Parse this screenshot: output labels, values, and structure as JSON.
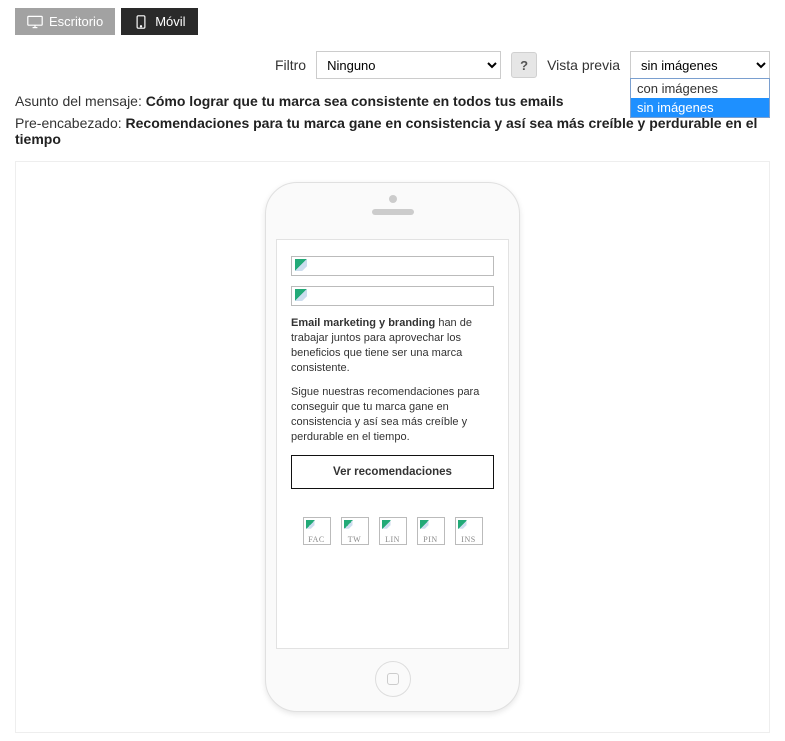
{
  "view_toggle": {
    "desktop_label": "Escritorio",
    "mobile_label": "Móvil"
  },
  "controls": {
    "filter_label": "Filtro",
    "filter_value": "Ninguno",
    "help_icon": "?",
    "preview_label": "Vista previa",
    "preview_value": "sin imágenes",
    "preview_options": {
      "with_images": "con imágenes",
      "without_images": "sin imágenes"
    }
  },
  "meta": {
    "subject_label": "Asunto del mensaje: ",
    "subject_value": "Cómo lograr que tu marca sea consistente en todos tus emails",
    "preheader_label": "Pre-encabezado: ",
    "preheader_value": "Recomendaciones para tu marca gane en consistencia y así sea más creíble y perdurable en el tiempo"
  },
  "email": {
    "body_strong": "Email marketing y branding",
    "body_p1_rest": " han de trabajar juntos para aprovechar los beneficios que tiene ser una marca consistente.",
    "body_p2": "Sigue nuestras recomendaciones para conseguir que tu marca gane en consistencia y así sea más creíble y perdurable en el tiempo.",
    "cta": "Ver recomendaciones",
    "socials": {
      "facebook": "FAC",
      "twitter": "TW",
      "linkedin": "LIN",
      "pinterest": "PIN",
      "instagram": "INS"
    }
  }
}
